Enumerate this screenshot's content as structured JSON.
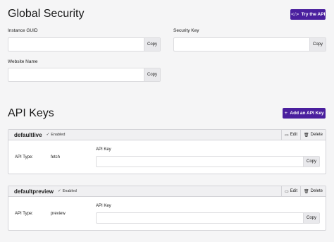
{
  "global": {
    "title": "Global Security",
    "try_api": "Try the API",
    "try_api_icon": "code-icon",
    "instance_guid_label": "Instance GUID",
    "security_key_label": "Security Key",
    "website_name_label": "Website Name",
    "copy": "Copy"
  },
  "api": {
    "title": "API Keys",
    "add_label": "Add an API Key",
    "add_icon": "plus-icon",
    "edit": "Edit",
    "delete": "Delete",
    "api_type_label": "API Type:",
    "api_key_label": "API Key",
    "copy": "Copy",
    "keys": [
      {
        "name": "defaultlive",
        "status": "Enabled",
        "type": "fetch"
      },
      {
        "name": "defaultpreview",
        "status": "Enabled",
        "type": "preview"
      }
    ]
  },
  "colors": {
    "accent": "#4a1f9e",
    "background": "#f5f5f6"
  }
}
